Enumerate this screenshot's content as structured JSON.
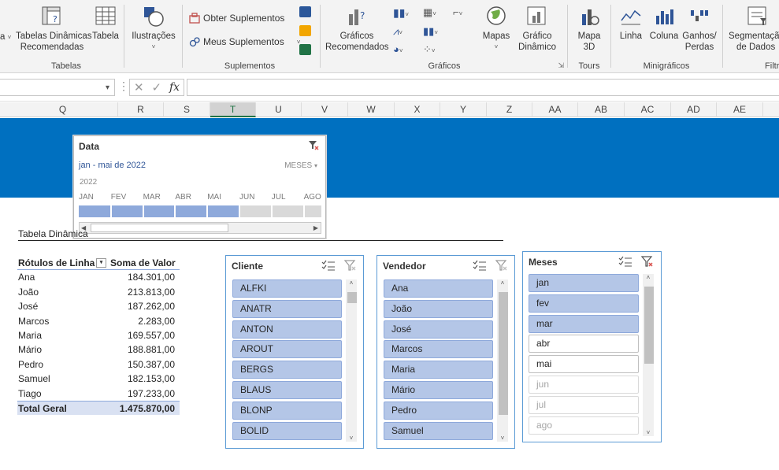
{
  "ribbon": {
    "left_partial": {
      "line1": "",
      "line2": "a",
      "caret": "˅"
    },
    "tabelas": {
      "recomendadas": {
        "line1": "Tabelas Dinâmicas",
        "line2": "Recomendadas"
      },
      "tabela": "Tabela",
      "label": "Tabelas"
    },
    "ilustracoes": {
      "label": "Ilustrações",
      "caret": "˅"
    },
    "suplementos": {
      "obter": "Obter Suplementos",
      "meus": "Meus Suplementos",
      "caret": "˅",
      "label": "Suplementos"
    },
    "graficos": {
      "recomendados": {
        "line1": "Gráficos",
        "line2": "Recomendados"
      },
      "mapas": "Mapas",
      "dinamico": {
        "line1": "Gráfico",
        "line2": "Dinâmico"
      },
      "label": "Gráficos"
    },
    "tours": {
      "mapa3d": {
        "line1": "Mapa",
        "line2": "3D"
      },
      "label": "Tours"
    },
    "minigraficos": {
      "linha": "Linha",
      "coluna": "Coluna",
      "ganhos": {
        "line1": "Ganhos/",
        "line2": "Perdas"
      },
      "label": "Minigráficos"
    },
    "filtros": {
      "segmentacao": {
        "line1": "Segmentação",
        "line2": "de Dados"
      },
      "label": "Filtros"
    }
  },
  "formula_bar": {
    "namebox_value": "",
    "formula_value": "",
    "fx": "fx",
    "cancel": "✕",
    "enter": "✓",
    "more": "⋮"
  },
  "columns": [
    "Q",
    "R",
    "S",
    "T",
    "U",
    "V",
    "W",
    "X",
    "Y",
    "Z",
    "AA",
    "AB",
    "AC",
    "AD",
    "AE"
  ],
  "selected_column": "T",
  "timeline": {
    "title": "Data",
    "range": "jan - mai de 2022",
    "level": "MESES",
    "year": "2022",
    "months": [
      "JAN",
      "FEV",
      "MAR",
      "ABR",
      "MAI",
      "JUN",
      "JUL",
      "AGO"
    ],
    "selected_months": 5
  },
  "pivot": {
    "caption": "Tabela Dinâmica",
    "header": {
      "rows": "Rótulos de Linha",
      "values": "Soma de Valor"
    },
    "rows": [
      {
        "name": "Ana",
        "value": "184.301,00"
      },
      {
        "name": "João",
        "value": "213.813,00"
      },
      {
        "name": "José",
        "value": "187.262,00"
      },
      {
        "name": "Marcos",
        "value": "2.283,00"
      },
      {
        "name": "Maria",
        "value": "169.557,00"
      },
      {
        "name": "Mário",
        "value": "188.881,00"
      },
      {
        "name": "Pedro",
        "value": "150.387,00"
      },
      {
        "name": "Samuel",
        "value": "182.153,00"
      },
      {
        "name": "Tiago",
        "value": "197.233,00"
      }
    ],
    "total": {
      "name": "Total Geral",
      "value": "1.475.870,00"
    }
  },
  "slicers": {
    "cliente": {
      "title": "Cliente",
      "items": [
        "ALFKI",
        "ANATR",
        "ANTON",
        "AROUT",
        "BERGS",
        "BLAUS",
        "BLONP",
        "BOLID"
      ]
    },
    "vendedor": {
      "title": "Vendedor",
      "items": [
        "Ana",
        "João",
        "José",
        "Marcos",
        "Maria",
        "Mário",
        "Pedro",
        "Samuel"
      ]
    },
    "meses": {
      "title": "Meses",
      "items": [
        {
          "label": "jan",
          "state": "sel"
        },
        {
          "label": "fev",
          "state": "sel"
        },
        {
          "label": "mar",
          "state": "sel"
        },
        {
          "label": "abr",
          "state": "avail"
        },
        {
          "label": "mai",
          "state": "avail"
        },
        {
          "label": "jun",
          "state": "nodata"
        },
        {
          "label": "jul",
          "state": "nodata"
        },
        {
          "label": "ago",
          "state": "nodata"
        }
      ]
    }
  },
  "colors": {
    "accent": "#217346",
    "banner": "#0070c0",
    "slicer_selected": "#b4c6e7",
    "timeline_fill": "#8ea9db"
  }
}
